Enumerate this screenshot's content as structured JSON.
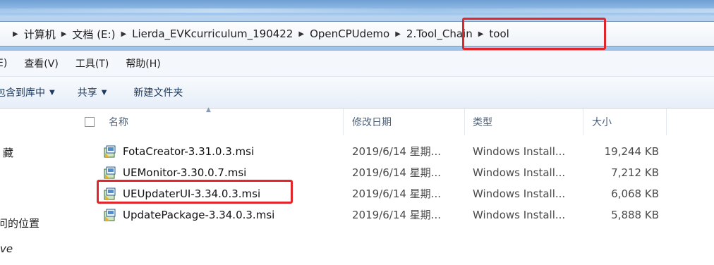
{
  "breadcrumbs": [
    "计算机",
    "文档 (E:)",
    "Lierda_EVKcurriculum_190422",
    "OpenCPUdemo",
    "2.Tool_Chain",
    "tool"
  ],
  "menu": [
    "E)",
    "查看(V)",
    "工具(T)",
    "帮助(H)"
  ],
  "toolbar": {
    "include_label": "包含到库中",
    "share_label": "共享",
    "new_folder_label": "新建文件夹"
  },
  "nav": [
    "藏",
    "问的位置",
    "ve"
  ],
  "columns": {
    "name": "名称",
    "date": "修改日期",
    "type": "类型",
    "size": "大小"
  },
  "files": [
    {
      "name": "FotaCreator-3.31.0.3.msi",
      "date": "2019/6/14 星期...",
      "type": "Windows Install...",
      "size": "19,244 KB"
    },
    {
      "name": "UEMonitor-3.30.0.7.msi",
      "date": "2019/6/14 星期...",
      "type": "Windows Install...",
      "size": "7,212 KB"
    },
    {
      "name": "UEUpdaterUI-3.34.0.3.msi",
      "date": "2019/6/14 星期...",
      "type": "Windows Install...",
      "size": "6,068 KB"
    },
    {
      "name": "UpdatePackage-3.34.0.3.msi",
      "date": "2019/6/14 星期...",
      "type": "Windows Install...",
      "size": "5,888 KB"
    }
  ],
  "colors": {
    "highlight": "#e0262a",
    "titlebar": "#8fbbe6"
  },
  "icons": {
    "crumb_separator": "triangle-right-icon",
    "file": "msi-installer-icon"
  }
}
